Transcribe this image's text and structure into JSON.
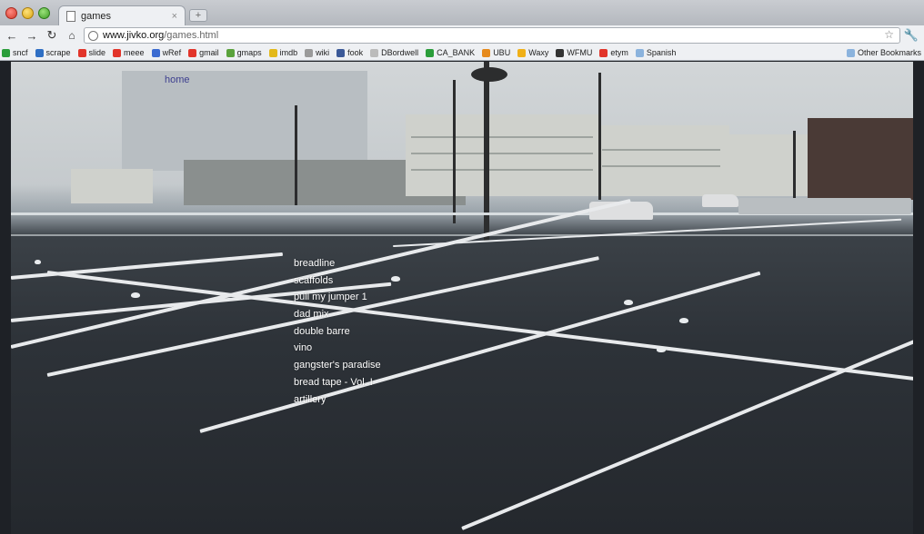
{
  "browser": {
    "tab_title": "games",
    "tab_close": "×",
    "new_tab": "+",
    "url_host": "www.jivko.org",
    "url_path": "/games.html"
  },
  "bookmarks": [
    {
      "label": "sncf",
      "icon": "sncf-icon",
      "color": "#2a9d3a"
    },
    {
      "label": "scrape",
      "icon": "scrape-icon",
      "color": "#2f6fc4"
    },
    {
      "label": "slide",
      "icon": "slide-icon",
      "color": "#e2342a"
    },
    {
      "label": "meee",
      "icon": "meee-icon",
      "color": "#e2342a"
    },
    {
      "label": "wRef",
      "icon": "wref-icon",
      "color": "#3b6bd1"
    },
    {
      "label": "gmail",
      "icon": "gmail-icon",
      "color": "#e2342a"
    },
    {
      "label": "gmaps",
      "icon": "gmaps-icon",
      "color": "#5aa23c"
    },
    {
      "label": "imdb",
      "icon": "imdb-icon",
      "color": "#e3b91a"
    },
    {
      "label": "wiki",
      "icon": "wiki-icon",
      "color": "#9a9a9a"
    },
    {
      "label": "fook",
      "icon": "fook-icon",
      "color": "#3b5998"
    },
    {
      "label": "DBordwell",
      "icon": "dbordwell-icon",
      "color": "#bbbbbb"
    },
    {
      "label": "CA_BANK",
      "icon": "ca-bank-icon",
      "color": "#2a9d3a"
    },
    {
      "label": "UBU",
      "icon": "ubu-icon",
      "color": "#e68a1c"
    },
    {
      "label": "Waxy",
      "icon": "waxy-icon",
      "color": "#f0b018"
    },
    {
      "label": "WFMU",
      "icon": "wfmu-icon",
      "color": "#333333"
    },
    {
      "label": "etym",
      "icon": "etym-icon",
      "color": "#e2342a"
    },
    {
      "label": "Spanish",
      "icon": "folder-icon",
      "color": "#8bb3dd"
    }
  ],
  "other_bookmarks": "Other Bookmarks",
  "page": {
    "home_link": "home",
    "games": [
      "breadline",
      "scaffolds",
      "pull my jumper 1",
      "dad mix",
      "double barre",
      "vino",
      "gangster's paradise",
      "bread tape - Vol. I",
      "artillery"
    ]
  }
}
